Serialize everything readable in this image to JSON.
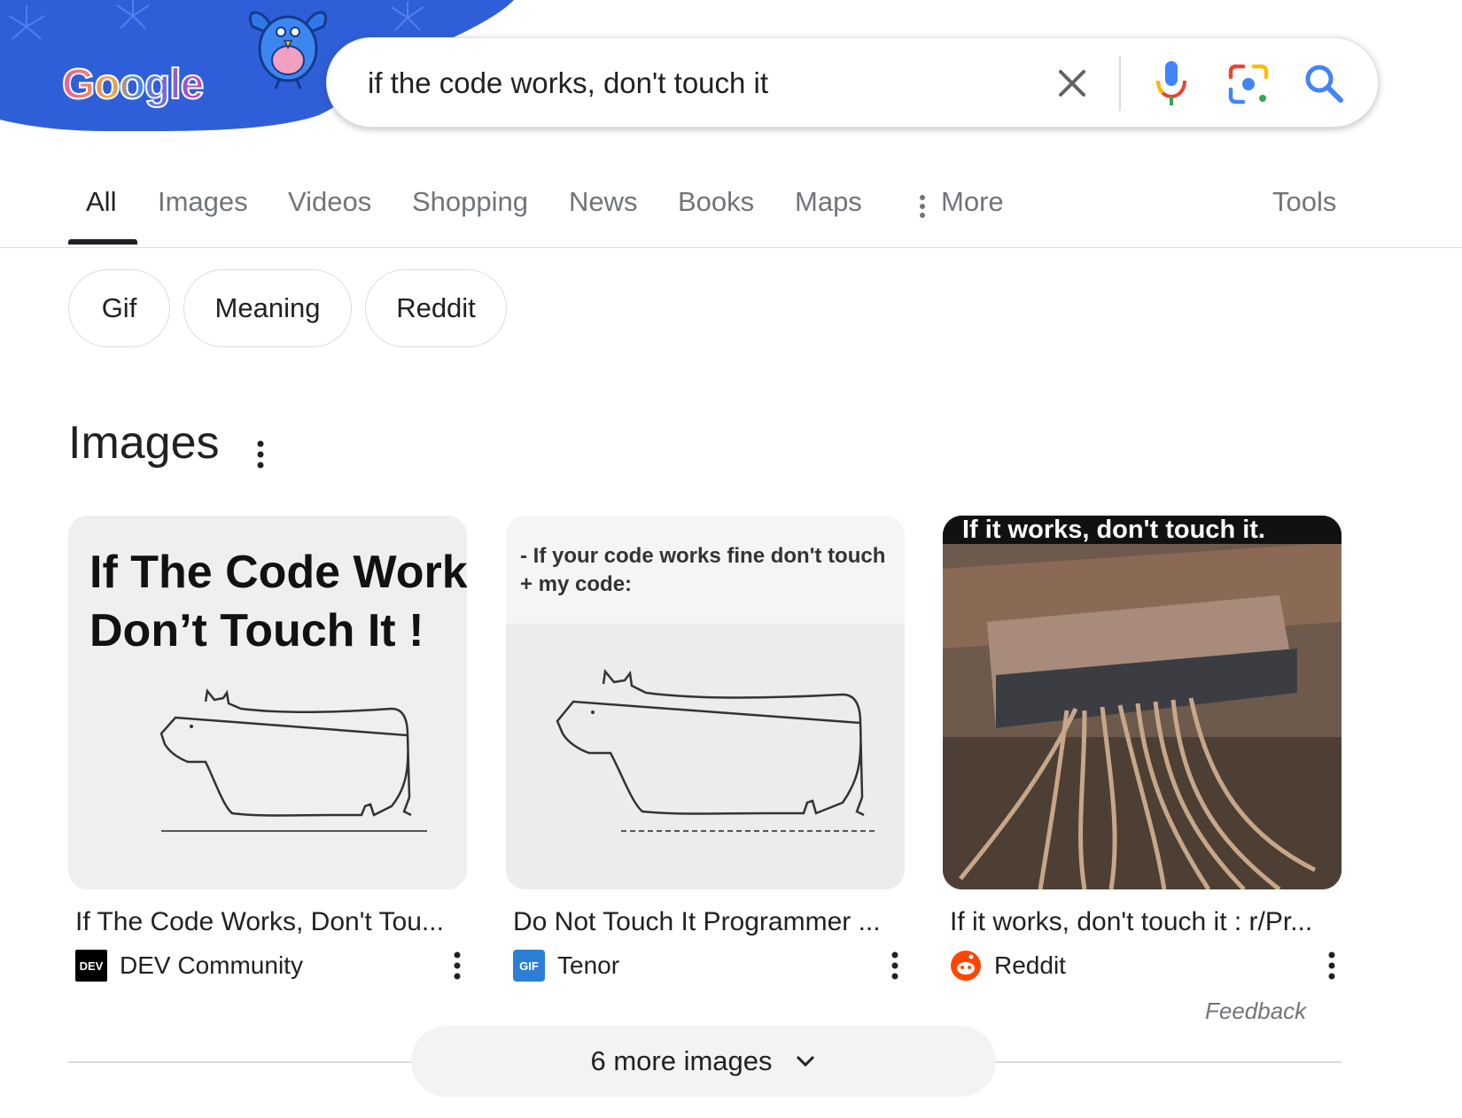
{
  "header": {
    "logo_text": "Google",
    "search": {
      "value": "if the code works, don't touch it",
      "icons": [
        "clear-icon",
        "mic-icon",
        "lens-icon",
        "search-icon"
      ]
    }
  },
  "tabs": [
    {
      "label": "All",
      "active": true
    },
    {
      "label": "Images"
    },
    {
      "label": "Videos"
    },
    {
      "label": "Shopping"
    },
    {
      "label": "News"
    },
    {
      "label": "Books"
    },
    {
      "label": "Maps"
    },
    {
      "label": "More"
    }
  ],
  "tools_label": "Tools",
  "chips": [
    "Gif",
    "Meaning",
    "Reddit"
  ],
  "images_section": {
    "title": "Images",
    "cards": [
      {
        "thumb_text_line1": "If The Code Work",
        "thumb_text_line2": "Don’t Touch It !",
        "title": "If The Code Works, Don't Tou...",
        "source": "DEV Community",
        "favicon_text": "DEV"
      },
      {
        "thumb_text_line1": "- If your code works fine don't touch",
        "thumb_text_line2": "+ my code:",
        "title": "Do Not Touch It Programmer ...",
        "source": "Tenor",
        "favicon_text": "GIF"
      },
      {
        "thumb_text_line1": "If it works, don't touch it.",
        "title": "If it works, don't touch it : r/Pr...",
        "source": "Reddit"
      }
    ],
    "feedback": "Feedback",
    "more_button": "6 more images"
  },
  "colors": {
    "doodle_blue": "#2f5fd8",
    "google_blue": "#4285f4",
    "google_red": "#ea4335",
    "google_yellow": "#fbbc04",
    "google_green": "#34a853",
    "reddit": "#ff4500",
    "tenor": "#2b7fd4"
  }
}
